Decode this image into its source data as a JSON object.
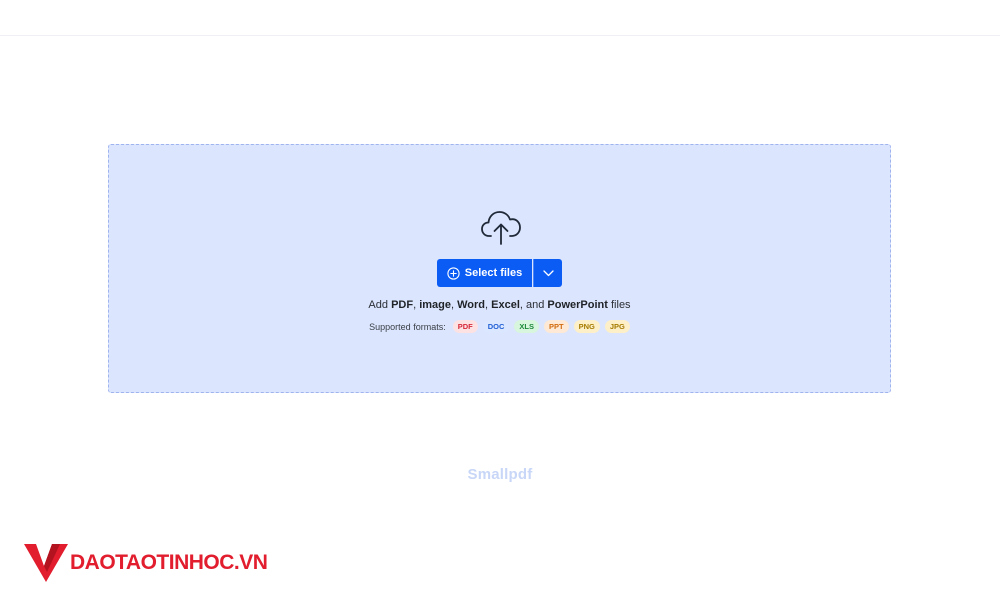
{
  "upload": {
    "select_label": "Select files",
    "add_prefix": "Add ",
    "add_pdf": "PDF",
    "add_sep1": ", ",
    "add_image": "image",
    "add_sep2": ", ",
    "add_word": "Word",
    "add_sep3": ", ",
    "add_excel": "Excel",
    "add_sep4": ", and ",
    "add_ppt": "PowerPoint",
    "add_suffix": " files",
    "formats_label": "Supported formats:",
    "formats": [
      "PDF",
      "DOC",
      "XLS",
      "PPT",
      "PNG",
      "JPG"
    ]
  },
  "brand": {
    "name": "Smallpdf"
  },
  "watermark": {
    "text": "DAOTAOTINHOC.VN"
  },
  "colors": {
    "accent": "#0a5cf5",
    "dropzone_bg": "#dbe5fd",
    "watermark": "#e11d2e"
  },
  "icons": {
    "upload": "cloud-upload-icon",
    "plus": "plus-circle-icon",
    "chevron": "chevron-down-icon"
  }
}
